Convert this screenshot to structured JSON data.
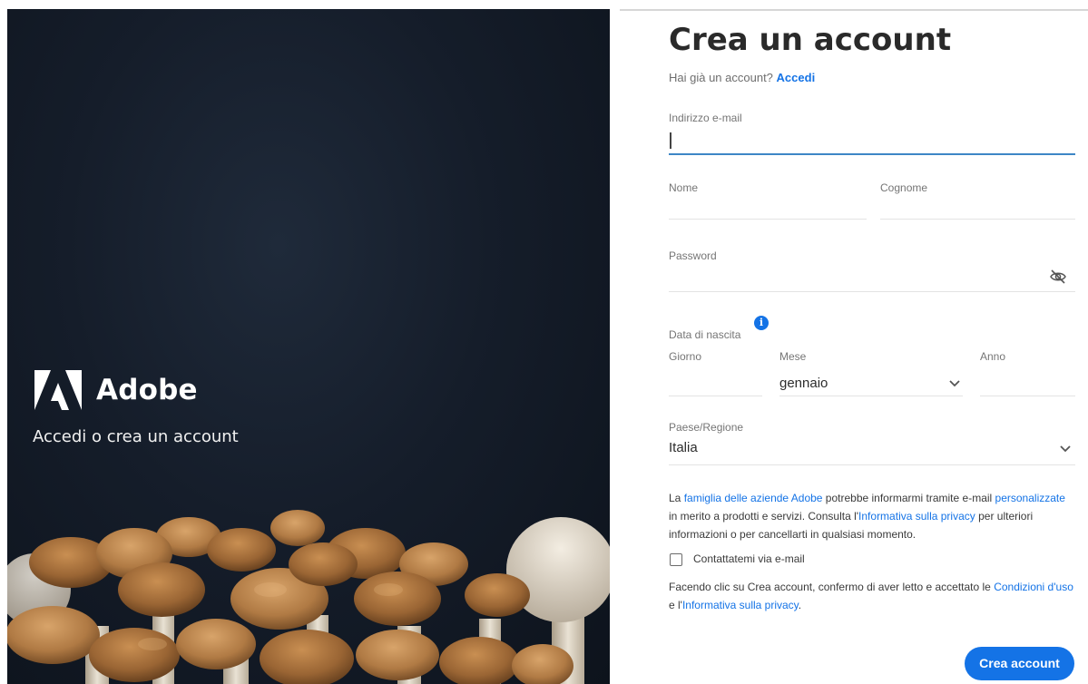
{
  "hero": {
    "brand_name": "Adobe",
    "tagline": "Accedi o crea un account",
    "logo_icon": "adobe-logo-icon"
  },
  "form": {
    "title": "Crea un account",
    "have_account_text": "Hai già un account?",
    "signin_link": "Accedi",
    "email_label": "Indirizzo e-mail",
    "email_value": "",
    "first_name_label": "Nome",
    "last_name_label": "Cognome",
    "password_label": "Password",
    "password_toggle_icon": "eye-off-icon",
    "dob_label": "Data di nascita",
    "dob_info_icon": "info-icon",
    "day_label": "Giorno",
    "month_label": "Mese",
    "month_value": "gennaio",
    "year_label": "Anno",
    "country_label": "Paese/Regione",
    "country_value": "Italia",
    "legal": {
      "p1_a": "La ",
      "p1_link1": "famiglia delle aziende Adobe",
      "p1_b": " potrebbe informarmi tramite e-mail ",
      "p1_link2": "personalizzate",
      "p1_c": " in merito a prodotti e servizi. Consulta l'",
      "p1_link3": "Informativa sulla privacy",
      "p1_d": " per ulteriori informazioni o per cancellarti in qualsiasi momento.",
      "checkbox_label": "Contattatemi via e-mail",
      "checkbox_checked": false,
      "p2_a": "Facendo clic su Crea account, confermo di aver letto e accettato le ",
      "p2_link1": "Condizioni d'uso",
      "p2_b": " e l'",
      "p2_link2": "Informativa sulla privacy",
      "p2_c": "."
    },
    "submit_label": "Crea account"
  },
  "colors": {
    "accent": "#1473e6",
    "hero_bg": "#151d2a",
    "active_underline": "#3d86c6"
  }
}
